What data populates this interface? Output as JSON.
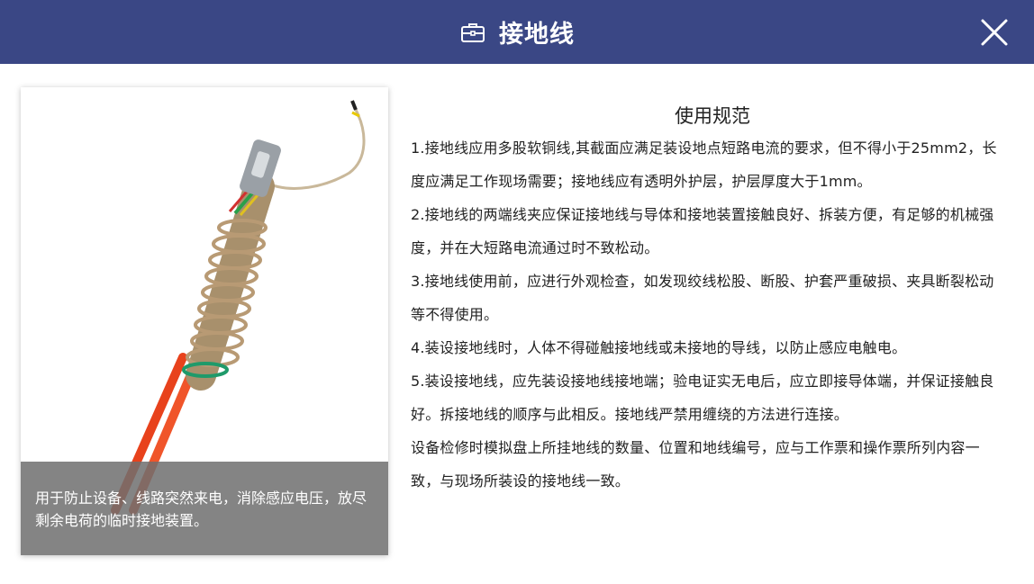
{
  "header": {
    "title": "接地线",
    "icon": "toolbox-icon",
    "close_icon": "close-icon",
    "background_color": "#3a4785"
  },
  "image_card": {
    "image_subject": "grounding-cable-photo",
    "caption": "用于防止设备、线路突然来电，消除感应电压，放尽剩余电荷的临时接地装置。"
  },
  "content": {
    "title": "使用规范",
    "paragraphs": [
      "1.接地线应用多股软铜线,其截面应满足装设地点短路电流的要求，但不得小于25mm2，长度应满足工作现场需要；接地线应有透明外护层，护层厚度大于1mm。",
      "2.接地线的两端线夹应保证接地线与导体和接地装置接触良好、拆装方便，有足够的机械强度，并在大短路电流通过时不致松动。",
      "3.接地线使用前，应进行外观检查，如发现绞线松股、断股、护套严重破损、夹具断裂松动等不得使用。",
      "4.装设接地线时，人体不得碰触接地线或未接地的导线，以防止感应电触电。",
      "5.装设接地线，应先装设接地线接地端；验电证实无电后，应立即接导体端，并保证接触良好。拆接地线的顺序与此相反。接地线严禁用缠绕的方法进行连接。",
      "设备检修时模拟盘上所挂地线的数量、位置和地线编号，应与工作票和操作票所列内容一致，与现场所装设的接地线一致。"
    ]
  }
}
